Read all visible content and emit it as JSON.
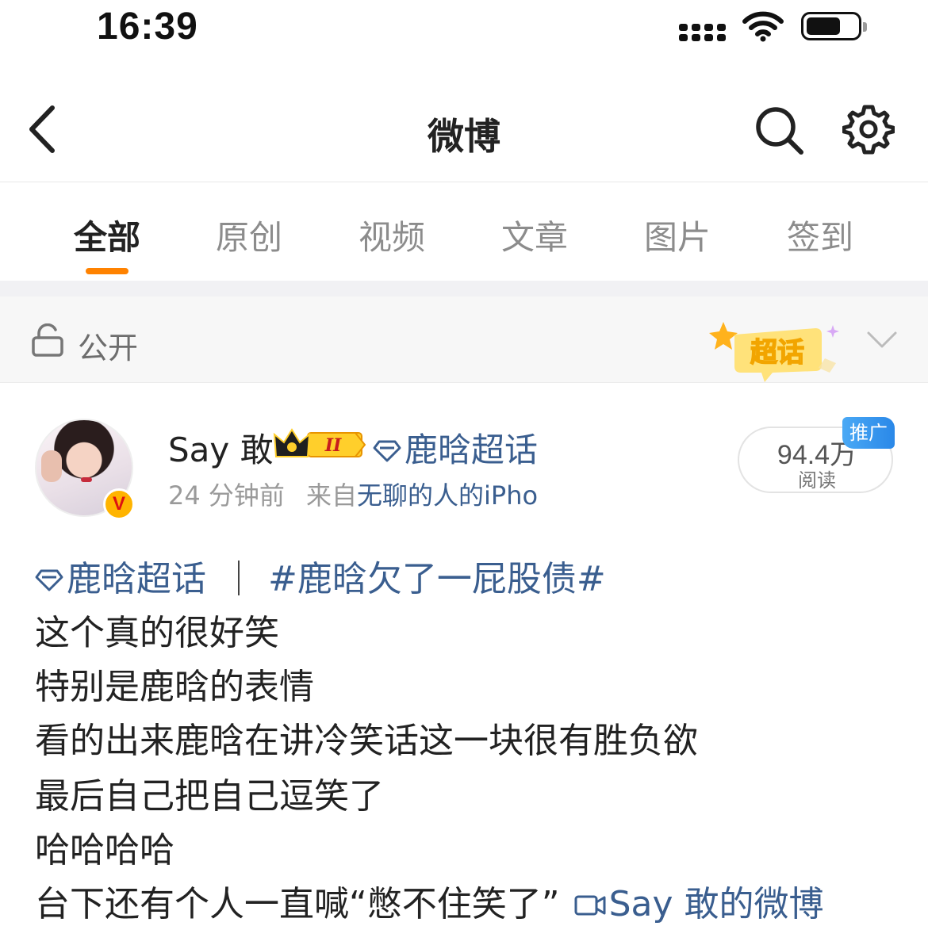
{
  "status_bar": {
    "time": "16:39"
  },
  "nav": {
    "title": "微博"
  },
  "tabs": [
    {
      "label": "全部",
      "active": true
    },
    {
      "label": "原创",
      "active": false
    },
    {
      "label": "视频",
      "active": false
    },
    {
      "label": "文章",
      "active": false
    },
    {
      "label": "图片",
      "active": false
    },
    {
      "label": "签到",
      "active": false
    }
  ],
  "visibility": {
    "label": "公开",
    "chaohua_badge": "超话"
  },
  "post": {
    "username": "Say 敢",
    "level_badge": "II",
    "topic_tag": "鹿晗超话",
    "time_ago": "24 分钟前",
    "source_prefix": "来自",
    "source_app": "无聊的人的iPho",
    "read_count": "94.4万",
    "read_label": "阅读",
    "promo_label": "推广",
    "body": {
      "topic": "鹿晗超话",
      "hashtag": "#鹿晗欠了一屁股债#",
      "lines": [
        "这个真的很好笑",
        "特别是鹿晗的表情",
        "看的出来鹿晗在讲冷笑话这一块很有胜负欲",
        "最后自己把自己逗笑了",
        "哈哈哈哈",
        "台下还有个人一直喊“憋不住笑了”"
      ],
      "video_link": "Say 敢的微博"
    }
  },
  "colors": {
    "accent": "#ff8200",
    "link": "#3a5e8f",
    "promo": "#2a88e8",
    "verified": "#ffb400"
  }
}
